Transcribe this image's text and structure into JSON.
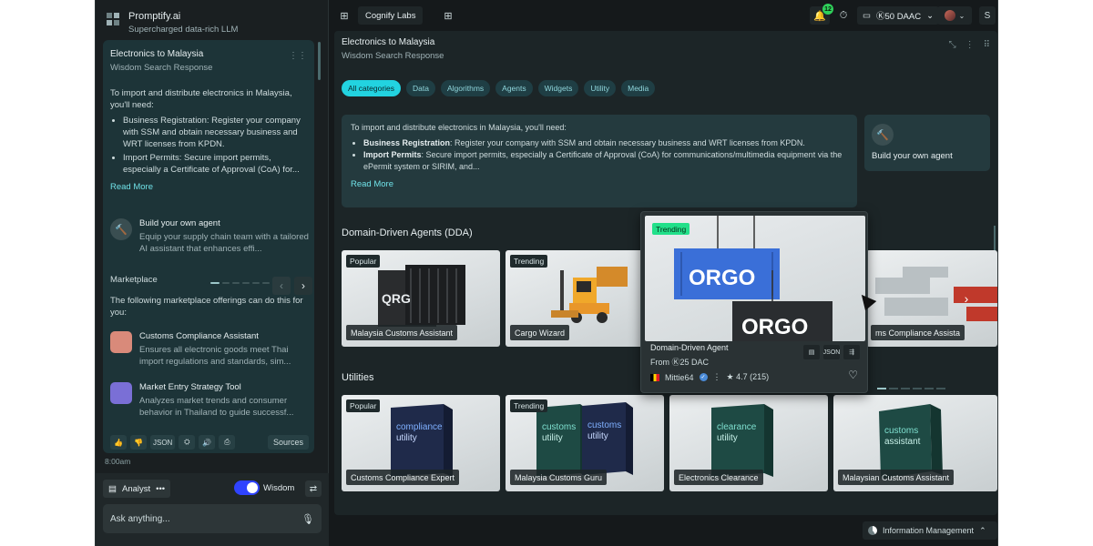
{
  "brand": {
    "name": "Promptify.ai",
    "tagline": "Supercharged data-rich LLM",
    "logo_icon": "promptify-logo-icon"
  },
  "chat": {
    "title": "Electronics to Malaysia",
    "subtitle": "Wisdom Search Response",
    "intro": "To import and distribute electronics in Malaysia, you'll need:",
    "bullets": [
      "Business Registration: Register your company with SSM and obtain necessary business and WRT licenses from KPDN.",
      "Import Permits: Secure import permits, especially a Certificate of Approval (CoA) for..."
    ],
    "read_more": "Read More",
    "agent": {
      "title": "Build your own agent",
      "desc": "Equip your supply chain team with a tailored AI assistant that enhances effi..."
    },
    "marketplace_label": "Marketplace",
    "marketplace_desc": "The following marketplace offerings can do this for you:",
    "offers": [
      {
        "title": "Customs Compliance Assistant",
        "desc": "Ensures all electronic goods meet Thai import regulations and standards, sim...",
        "color": "#d98a7a"
      },
      {
        "title": "Market Entry Strategy Tool",
        "desc": "Analyzes market trends and consumer behavior in Thailand to guide successf...",
        "color": "#7a6fd6"
      }
    ],
    "tools": [
      "👍",
      "👎",
      "JSON",
      "⛭",
      "🔊",
      "⎙"
    ],
    "sources_label": "Sources",
    "time": "8:00am"
  },
  "composer": {
    "mode": "Analyst",
    "mode_more": "•••",
    "wisdom_label": "Wisdom",
    "wisdom_on": true,
    "placeholder": "Ask anything..."
  },
  "topbar": {
    "workspace": "Cognify Labs",
    "notifications": "12",
    "wallet": "Ⓚ50 DAAC",
    "more": "S"
  },
  "main": {
    "title": "Electronics to Malaysia",
    "subtitle": "Wisdom Search Response",
    "categories": [
      "All categories",
      "Data",
      "Algorithms",
      "Agents",
      "Widgets",
      "Utility",
      "Media"
    ],
    "answer": {
      "intro": "To import and distribute electronics in Malaysia, you'll need:",
      "b1_label": "Business Registration",
      "b1_text": ": Register your company with SSM and obtain necessary business and WRT licenses from KPDN.",
      "b2_label": "Import Permits",
      "b2_text": ": Secure import permits, especially a Certificate of Approval (CoA) for communications/multimedia equipment via the ePermit system or SIRIM, and...",
      "read_more": "Read More"
    },
    "build_agent": "Build your own agent",
    "dda_title": "Domain-Driven Agents (DDA)",
    "dda_cards": [
      {
        "tag": "Popular",
        "name": "Malaysia Customs Assistant"
      },
      {
        "tag": "Trending",
        "name": "Cargo  Wizard"
      },
      {
        "tag": "",
        "name": "ms Compliance Assista"
      }
    ],
    "utilities_title": "Utilities",
    "utility_cards": [
      {
        "tag": "Popular",
        "name": "Customs Compliance Expert",
        "box": "compliance utility",
        "box1": "compliance",
        "box2": "utility"
      },
      {
        "tag": "Trending",
        "name": "Malaysia Customs Guru",
        "box1": "customs",
        "box2": "utility"
      },
      {
        "tag": "",
        "name": "Electronics Clearance",
        "box1": "clearance",
        "box2": "utility"
      },
      {
        "tag": "",
        "name": "Malaysian Customs Assistant",
        "box1": "customs",
        "box2": "assistant"
      }
    ],
    "popup": {
      "tag": "Trending",
      "type": "Domain-Driven Agent",
      "price": "From Ⓚ25 DAC",
      "author": "Mittie64",
      "rating": "★ 4.7 (215)",
      "container_text": "ORGO"
    },
    "bottom_label": "Information Management"
  }
}
